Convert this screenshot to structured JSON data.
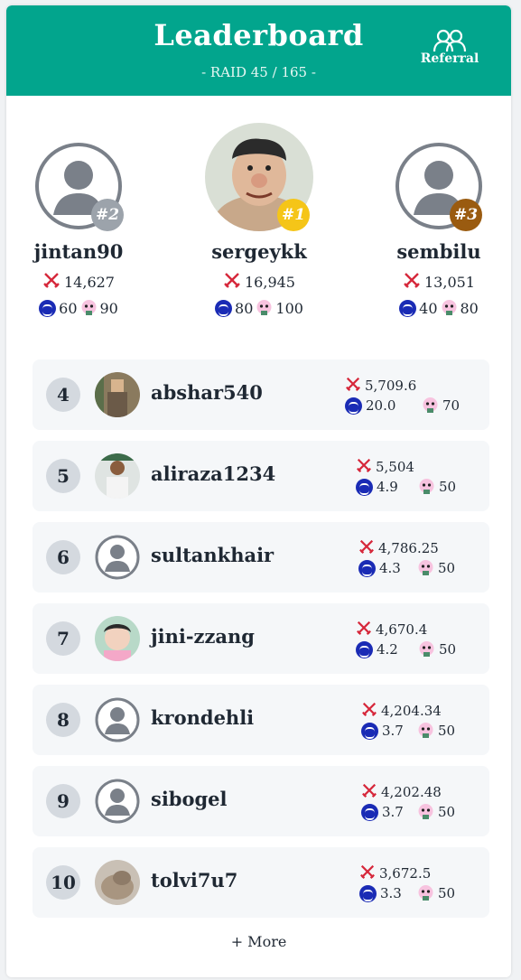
{
  "header": {
    "title": "Leaderboard",
    "subtitle": "- RAID 45 / 165 -",
    "referral_label": "Referral",
    "color": "#02a58d"
  },
  "podium": [
    {
      "rank": "#2",
      "name": "jintan90",
      "damage": "14,627",
      "steem": "60",
      "pets": "90",
      "badge_color": "#9ca3ab",
      "avatar": "default"
    },
    {
      "rank": "#1",
      "name": "sergeykk",
      "damage": "16,945",
      "steem": "80",
      "pets": "100",
      "badge_color": "#f5c518",
      "avatar": "photo"
    },
    {
      "rank": "#3",
      "name": "sembilu",
      "damage": "13,051",
      "steem": "40",
      "pets": "80",
      "badge_color": "#9a5b10",
      "avatar": "default"
    }
  ],
  "rows": [
    {
      "rank": "4",
      "name": "abshar540",
      "damage": "5,709.6",
      "steem": "20.0",
      "pets": "70",
      "avatar": "photo"
    },
    {
      "rank": "5",
      "name": "aliraza1234",
      "damage": "5,504",
      "steem": "4.9",
      "pets": "50",
      "avatar": "photo"
    },
    {
      "rank": "6",
      "name": "sultankhair",
      "damage": "4,786.25",
      "steem": "4.3",
      "pets": "50",
      "avatar": "default"
    },
    {
      "rank": "7",
      "name": "jini-zzang",
      "damage": "4,670.4",
      "steem": "4.2",
      "pets": "50",
      "avatar": "photo"
    },
    {
      "rank": "8",
      "name": "krondehli",
      "damage": "4,204.34",
      "steem": "3.7",
      "pets": "50",
      "avatar": "default"
    },
    {
      "rank": "9",
      "name": "sibogel",
      "damage": "4,202.48",
      "steem": "3.7",
      "pets": "50",
      "avatar": "default"
    },
    {
      "rank": "10",
      "name": "tolvi7u7",
      "damage": "3,672.5",
      "steem": "3.3",
      "pets": "50",
      "avatar": "photo"
    }
  ],
  "more_label": "+ More",
  "icons": {
    "damage": "crossed-swords-icon",
    "steem": "steem-coin-icon",
    "pets": "pet-icon"
  },
  "colors": {
    "swords": "#d6283b",
    "steem": "#1a2bb5",
    "row_bg": "#f5f7f9",
    "rank_bg": "#d4d9df"
  }
}
